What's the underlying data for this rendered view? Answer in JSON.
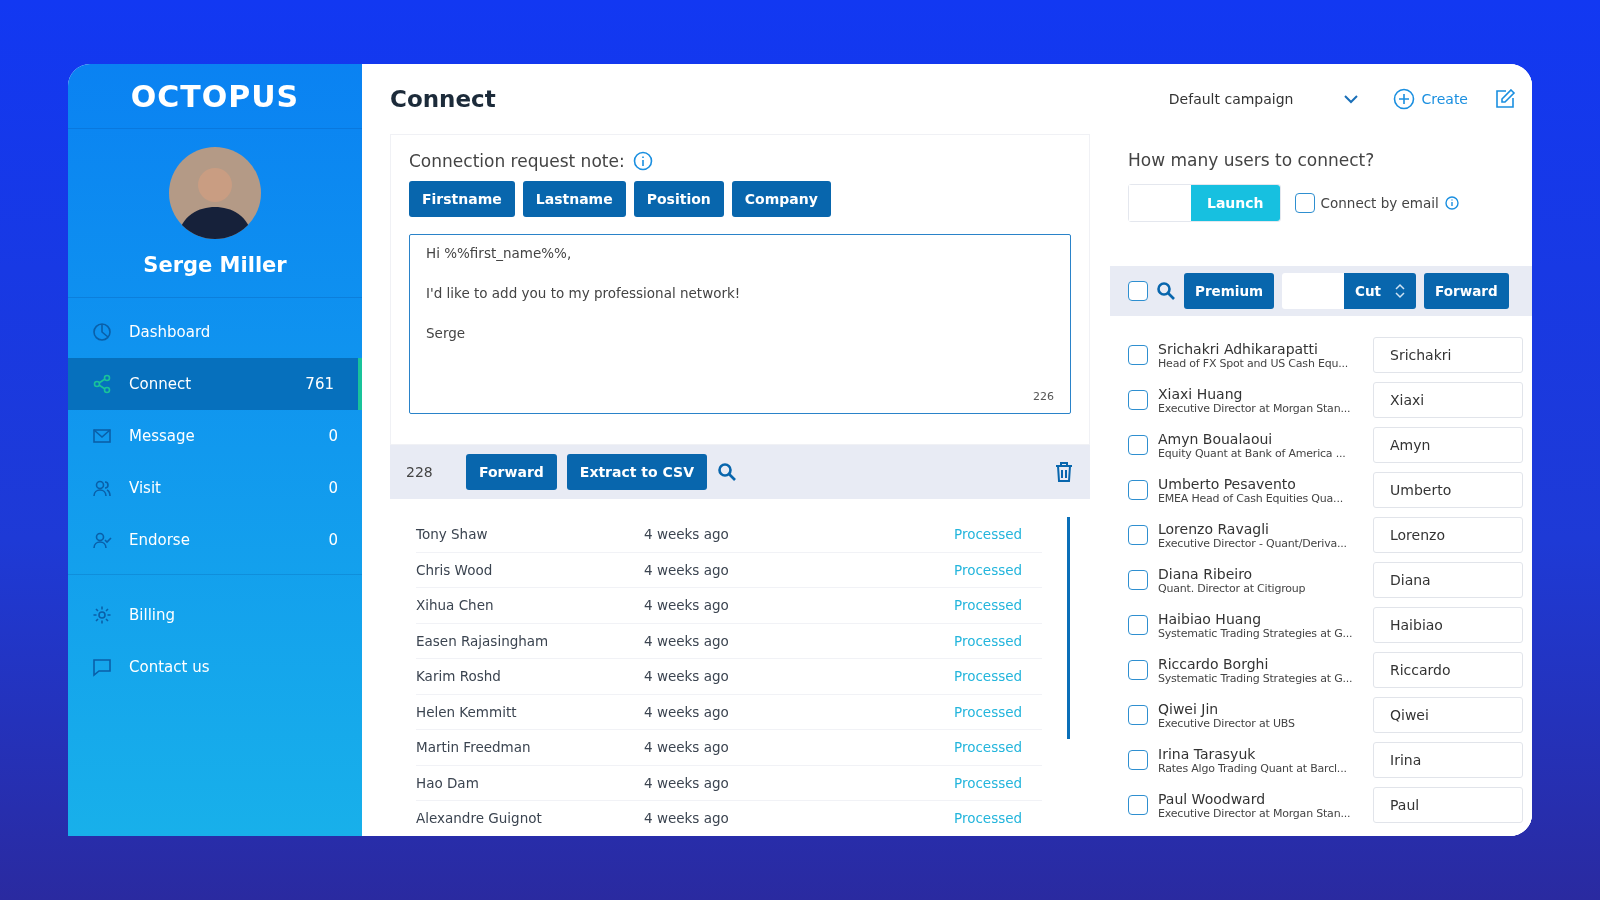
{
  "logo": "OCTOPUS",
  "profile": {
    "name": "Serge Miller"
  },
  "nav": [
    {
      "label": "Dashboard",
      "selected": false
    },
    {
      "label": "Connect",
      "count": "761",
      "selected": true
    },
    {
      "label": "Message",
      "count": "0",
      "selected": false
    },
    {
      "label": "Visit",
      "count": "0",
      "selected": false
    },
    {
      "label": "Endorse",
      "count": "0",
      "selected": false
    }
  ],
  "nav_secondary": [
    {
      "label": "Billing",
      "selected": false
    },
    {
      "label": "Contact us",
      "selected": false
    }
  ],
  "header": {
    "title": "Connect",
    "campaign": "Default campaign",
    "create": "Create"
  },
  "note": {
    "label": "Connection request note:",
    "tags": [
      "Firstname",
      "Lastname",
      "Position",
      "Company"
    ],
    "lines": [
      "Hi %%first_name%%,",
      "I'd like to add you to my professional network!",
      "Serge"
    ],
    "counter": "226"
  },
  "history": {
    "count": "228",
    "buttons": [
      "Forward",
      "Extract to CSV"
    ],
    "rows": [
      {
        "name": "Tony Shaw",
        "time": "4 weeks ago",
        "status": "Processed"
      },
      {
        "name": "Chris Wood",
        "time": "4 weeks ago",
        "status": "Processed"
      },
      {
        "name": "Xihua Chen",
        "time": "4 weeks ago",
        "status": "Processed"
      },
      {
        "name": "Easen Rajasingham",
        "time": "4 weeks ago",
        "status": "Processed"
      },
      {
        "name": "Karim Roshd",
        "time": "4 weeks ago",
        "status": "Processed"
      },
      {
        "name": "Helen Kemmitt",
        "time": "4 weeks ago",
        "status": "Processed"
      },
      {
        "name": "Martin Freedman",
        "time": "4 weeks ago",
        "status": "Processed"
      },
      {
        "name": "Hao Dam",
        "time": "4 weeks ago",
        "status": "Processed"
      },
      {
        "name": "Alexandre Guignot",
        "time": "4 weeks ago",
        "status": "Processed"
      }
    ]
  },
  "users": {
    "question": "How many users to connect?",
    "launch": "Launch",
    "email_option": {
      "label": "Connect by email",
      "checked": false
    },
    "toolbar": {
      "select_all": false,
      "premium": "Premium",
      "cut": "Cut",
      "forward": "Forward"
    },
    "people": [
      {
        "name": "Srichakri Adhikarapatti",
        "title": "Head of FX Spot and US Cash Equ...",
        "first_name": "Srichakri",
        "checked": false
      },
      {
        "name": "Xiaxi Huang",
        "title": "Executive Director at Morgan Stan...",
        "first_name": "Xiaxi",
        "checked": false
      },
      {
        "name": "Amyn Boualaoui",
        "title": "Equity Quant at Bank of America ...",
        "first_name": "Amyn",
        "checked": false
      },
      {
        "name": "Umberto Pesavento",
        "title": "EMEA Head of Cash Equities Qua...",
        "first_name": "Umberto",
        "checked": false
      },
      {
        "name": "Lorenzo Ravagli",
        "title": "Executive Director - Quant/Deriva...",
        "first_name": "Lorenzo",
        "checked": false
      },
      {
        "name": "Diana Ribeiro",
        "title": "Quant. Director at Citigroup",
        "first_name": "Diana",
        "checked": false
      },
      {
        "name": "Haibiao Huang",
        "title": "Systematic Trading Strategies at G...",
        "first_name": "Haibiao",
        "checked": false
      },
      {
        "name": "Riccardo Borghi",
        "title": "Systematic Trading Strategies at G...",
        "first_name": "Riccardo",
        "checked": false
      },
      {
        "name": "Qiwei Jin",
        "title": "Executive Director at UBS",
        "first_name": "Qiwei",
        "checked": false
      },
      {
        "name": "Irina Tarasyuk",
        "title": "Rates Algo Trading Quant at Barcl...",
        "first_name": "Irina",
        "checked": false
      },
      {
        "name": "Paul Woodward",
        "title": "Executive Director at Morgan Stan...",
        "first_name": "Paul",
        "checked": false
      }
    ]
  }
}
